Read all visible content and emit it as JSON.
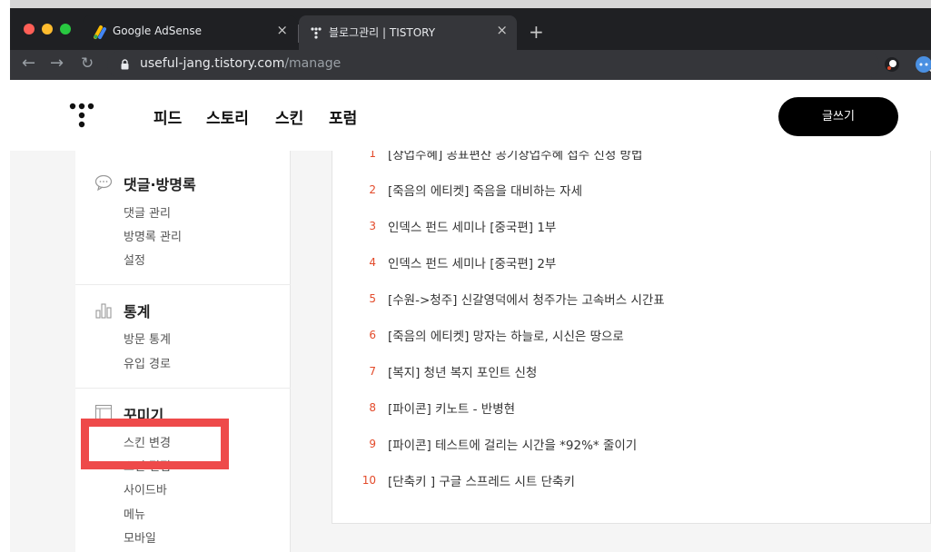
{
  "browser": {
    "tabs": [
      {
        "title": "Google AdSense",
        "close": "×"
      },
      {
        "title": "블로그관리 | TISTORY",
        "close": "×"
      }
    ],
    "new_tab": "+",
    "back": "←",
    "forward": "→",
    "reload": "↻",
    "url_host": "useful-jang.tistory.com",
    "url_path": "/manage",
    "star": "☆"
  },
  "topnav": {
    "links": [
      "피드",
      "스토리",
      "스킨",
      "포럼"
    ],
    "write_button": "글쓰기"
  },
  "sidebar": {
    "sections": [
      {
        "title": "댓글·방명록",
        "icon": "comment-icon",
        "items": [
          "댓글 관리",
          "방명록 관리",
          "설정"
        ]
      },
      {
        "title": "통계",
        "icon": "bar-chart-icon",
        "items": [
          "방문 통계",
          "유입 경로"
        ]
      },
      {
        "title": "꾸미기",
        "icon": "layout-icon",
        "items": [
          "스킨 변경",
          "스킨 편집",
          "사이드바",
          "메뉴",
          "모바일"
        ]
      }
    ]
  },
  "posts": [
    {
      "rank": "1",
      "title": "[창업수혜] 공표편찬 공기창업수혜 접수 신청 방법"
    },
    {
      "rank": "2",
      "title": "[죽음의 에티켓] 죽음을 대비하는 자세"
    },
    {
      "rank": "3",
      "title": "인덱스 펀드 세미나 [중국편] 1부"
    },
    {
      "rank": "4",
      "title": "인덱스 펀드 세미나 [중국편] 2부"
    },
    {
      "rank": "5",
      "title": "[수원->청주] 신갈영덕에서 청주가는 고속버스 시간표"
    },
    {
      "rank": "6",
      "title": "[죽음의 에티켓] 망자는 하늘로, 시신은 땅으로"
    },
    {
      "rank": "7",
      "title": "[복지] 청년 복지 포인트 신청"
    },
    {
      "rank": "8",
      "title": "[파이콘] 키노트 - 반병현"
    },
    {
      "rank": "9",
      "title": "[파이콘] 테스트에 걸리는 시간을 *92%* 줄이기"
    },
    {
      "rank": "10",
      "title": "[단축키 ] 구글 스프레드 시트 단축키"
    }
  ],
  "colors": {
    "rank_accent": "#e34a2a",
    "highlight": "#ee4a4a",
    "write_button_bg": "#000000"
  }
}
